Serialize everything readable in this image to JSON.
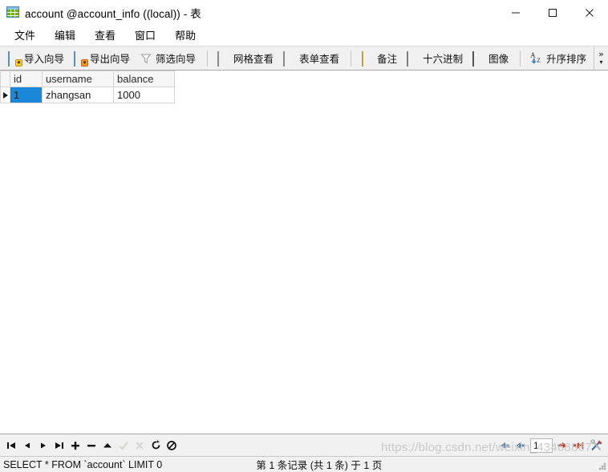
{
  "window": {
    "title": "account @account_info ((local)) - 表",
    "icon": "table-icon",
    "controls": {
      "minimize": "minimize-icon",
      "maximize": "maximize-icon",
      "close": "close-icon"
    }
  },
  "menu": {
    "items": [
      {
        "label": "文件"
      },
      {
        "label": "编辑"
      },
      {
        "label": "查看"
      },
      {
        "label": "窗口"
      },
      {
        "label": "帮助"
      }
    ]
  },
  "toolbar": {
    "groups": [
      {
        "buttons": [
          {
            "label": "导入向导",
            "icon": "import-wizard-icon"
          },
          {
            "label": "导出向导",
            "icon": "export-wizard-icon"
          },
          {
            "label": "筛选向导",
            "icon": "filter-wizard-icon"
          }
        ]
      },
      {
        "buttons": [
          {
            "label": "网格查看",
            "icon": "grid-view-icon"
          },
          {
            "label": "表单查看",
            "icon": "form-view-icon"
          }
        ]
      },
      {
        "buttons": [
          {
            "label": "备注",
            "icon": "memo-icon"
          },
          {
            "label": "十六进制",
            "icon": "hex-icon"
          },
          {
            "label": "图像",
            "icon": "image-icon"
          }
        ]
      },
      {
        "buttons": [
          {
            "label": "升序排序",
            "icon": "sort-ascending-icon"
          }
        ]
      }
    ],
    "overflow": {
      "chevron": "»",
      "triangle": "▾"
    }
  },
  "grid": {
    "columns": [
      {
        "key": "id",
        "label": "id"
      },
      {
        "key": "username",
        "label": "username"
      },
      {
        "key": "balance",
        "label": "balance"
      }
    ],
    "rows": [
      {
        "id": "1",
        "username": "zhangsan",
        "balance": "1000",
        "selected": true,
        "marker": "row-indicator-icon"
      }
    ]
  },
  "bottom_nav": {
    "buttons": [
      {
        "name": "first-record-button",
        "icon": "first-record-icon",
        "disabled": false
      },
      {
        "name": "previous-record-button",
        "icon": "previous-record-icon",
        "disabled": false
      },
      {
        "name": "next-record-button",
        "icon": "next-record-icon",
        "disabled": false
      },
      {
        "name": "last-record-button",
        "icon": "last-record-icon",
        "disabled": false
      },
      {
        "name": "add-record-button",
        "icon": "plus-icon",
        "disabled": false
      },
      {
        "name": "delete-record-button",
        "icon": "minus-icon",
        "disabled": false
      },
      {
        "name": "apply-change-button",
        "icon": "triangle-up-icon",
        "disabled": false
      },
      {
        "name": "confirm-button",
        "icon": "check-icon",
        "disabled": true
      },
      {
        "name": "cancel-button",
        "icon": "cross-icon",
        "disabled": true
      },
      {
        "name": "refresh-button",
        "icon": "refresh-icon",
        "disabled": false
      },
      {
        "name": "stop-button",
        "icon": "stop-icon",
        "disabled": false
      }
    ],
    "pager": {
      "first_page": "first-page-icon",
      "previous_page": "previous-page-icon",
      "page_value": "1",
      "next_page": "next-page-icon",
      "last_page": "last-page-icon",
      "tools": "tools-icon"
    }
  },
  "status": {
    "query": "SELECT * FROM `account` LIMIT 0",
    "record_info": "第 1 条记录 (共 1 条) 于 1 页"
  },
  "watermark": {
    "text": "https://blog.csdn.net/weixin_43468867"
  },
  "colors": {
    "selection": "#1a87d9",
    "toolbar_bg": "#f1f1f1",
    "header_bg": "#f6f6f6",
    "grid_border": "#d4d4d4"
  }
}
